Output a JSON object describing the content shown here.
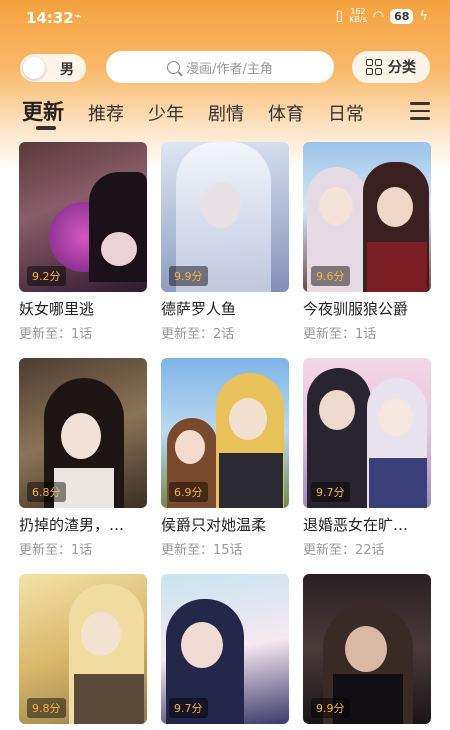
{
  "status_bar": {
    "time": "14:32",
    "usb_icon": "usb-icon",
    "net_speed_value": "162",
    "net_speed_unit": "KB/s",
    "battery": "68"
  },
  "header": {
    "gender_toggle_label": "男",
    "search_placeholder": "漫画/作者/主角",
    "category_label": "分类"
  },
  "tabs": [
    {
      "label": "更新",
      "active": true
    },
    {
      "label": "推荐"
    },
    {
      "label": "少年"
    },
    {
      "label": "剧情"
    },
    {
      "label": "体育"
    },
    {
      "label": "日常"
    }
  ],
  "comics": [
    {
      "title": "妖女哪里逃",
      "update": "更新至：1话",
      "rating": "9.2分"
    },
    {
      "title": "德萨罗人鱼",
      "update": "更新至：2话",
      "rating": "9.9分"
    },
    {
      "title": "今夜驯服狼公爵",
      "update": "更新至：1话",
      "rating": "9.6分"
    },
    {
      "title": "扔掉的渣男，…",
      "update": "更新至：1话",
      "rating": "6.8分"
    },
    {
      "title": "侯爵只对她温柔",
      "update": "更新至：15话",
      "rating": "6.9分"
    },
    {
      "title": "退婚恶女在旷…",
      "update": "更新至：22话",
      "rating": "9.7分"
    },
    {
      "title": "",
      "update": "",
      "rating": "9.8分"
    },
    {
      "title": "",
      "update": "",
      "rating": "9.7分"
    },
    {
      "title": "",
      "update": "",
      "rating": "9.9分"
    }
  ],
  "colors": {
    "header_orange": "#f5a23f",
    "rating_text": "#f7b246"
  }
}
